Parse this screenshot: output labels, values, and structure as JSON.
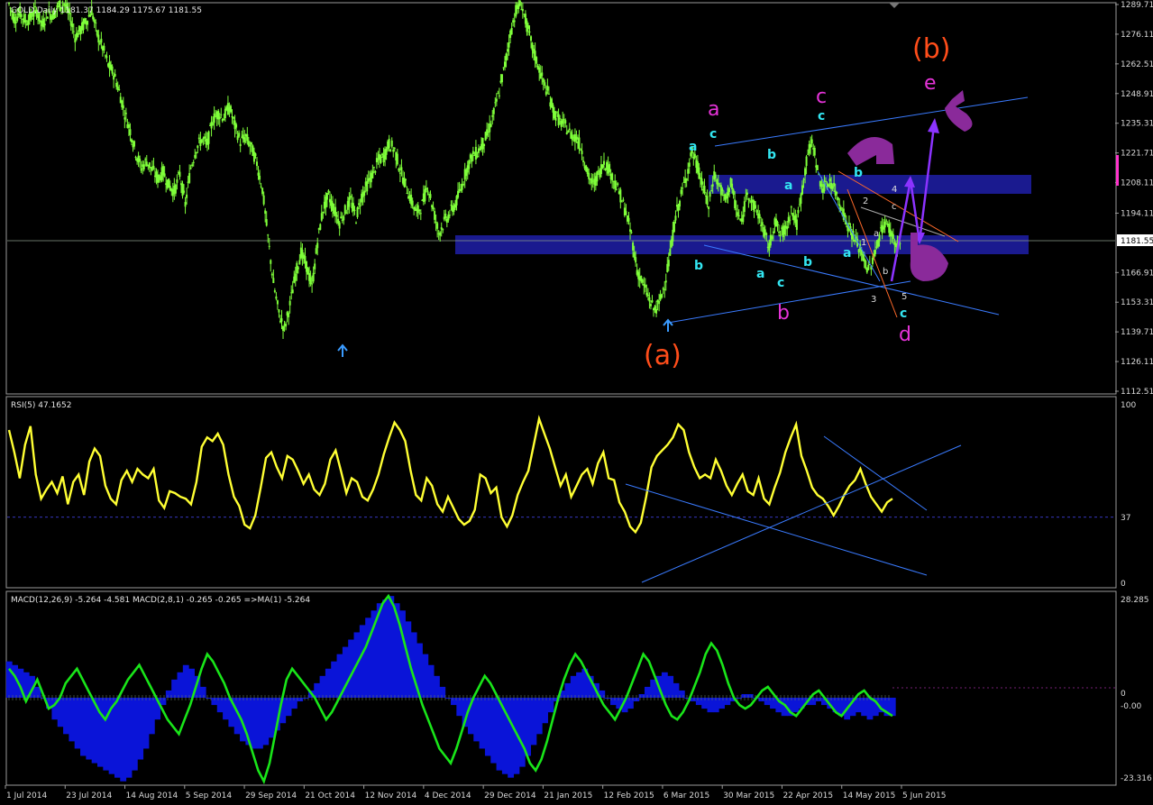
{
  "chart_data": [
    {
      "type": "candlestick",
      "header": "GOLD,Daily  1181.37 1184.29 1175.67 1181.55",
      "symbol": "GOLD",
      "timeframe": "Daily",
      "ohlc_last": {
        "open": 1181.37,
        "high": 1184.29,
        "low": 1175.67,
        "close": 1181.55
      },
      "ylim": [
        1112.51,
        1289.71
      ],
      "yticks": [
        1289.71,
        1276.11,
        1262.51,
        1248.91,
        1235.31,
        1221.71,
        1208.11,
        1194.11,
        1181.55,
        1166.91,
        1153.31,
        1139.71,
        1126.11,
        1112.51
      ],
      "current_price_label": "1181.55",
      "price_path": [
        1290,
        1283,
        1286,
        1282,
        1284,
        1287,
        1280,
        1286,
        1285,
        1289,
        1290,
        1285,
        1275,
        1278,
        1282,
        1287,
        1276,
        1270,
        1262,
        1258,
        1250,
        1240,
        1232,
        1222,
        1215,
        1218,
        1214,
        1210,
        1213,
        1207,
        1204,
        1212,
        1198,
        1215,
        1224,
        1228,
        1226,
        1237,
        1240,
        1238,
        1243,
        1234,
        1227,
        1229,
        1224,
        1217,
        1205,
        1183,
        1162,
        1148,
        1141,
        1152,
        1166,
        1176,
        1170,
        1160,
        1181,
        1196,
        1202,
        1196,
        1190,
        1195,
        1200,
        1192,
        1202,
        1207,
        1212,
        1218,
        1220,
        1226,
        1223,
        1214,
        1207,
        1200,
        1194,
        1198,
        1207,
        1196,
        1185,
        1190,
        1194,
        1198,
        1205,
        1214,
        1220,
        1222,
        1226,
        1231,
        1240,
        1250,
        1262,
        1276,
        1287,
        1290,
        1280,
        1270,
        1262,
        1254,
        1248,
        1240,
        1236,
        1234,
        1230,
        1229,
        1223,
        1212,
        1207,
        1212,
        1218,
        1214,
        1208,
        1202,
        1194,
        1184,
        1168,
        1162,
        1156,
        1150,
        1152,
        1162,
        1175,
        1193,
        1202,
        1212,
        1222,
        1215,
        1206,
        1197,
        1212,
        1206,
        1200,
        1208,
        1196,
        1189,
        1205,
        1198,
        1194,
        1186,
        1178,
        1191,
        1184,
        1187,
        1196,
        1189,
        1205,
        1222,
        1226,
        1210,
        1205,
        1209,
        1204,
        1198,
        1190,
        1185,
        1180,
        1174,
        1168,
        1174,
        1184,
        1190,
        1186,
        1179,
        1181
      ],
      "annotations": [
        "a",
        "c",
        "b",
        "a",
        "b",
        "a",
        "c",
        "b",
        "c",
        "c",
        "b",
        "e",
        "(b)",
        "(a)",
        "a",
        "1",
        "2",
        "3",
        "4",
        "5",
        "a",
        "b",
        "c",
        "d"
      ],
      "overlay_labels": {
        "big_a": "(a)",
        "big_b": "(b)",
        "wave_a": "a",
        "wave_b": "b",
        "wave_c": "c",
        "wave_d": "d",
        "wave_e": "e"
      }
    },
    {
      "type": "line",
      "header": "RSI(5) 47.1652",
      "ylim": [
        0,
        100
      ],
      "yticks": [
        "100",
        "37",
        "0"
      ],
      "level": 37,
      "values": [
        84,
        72,
        58,
        76,
        86,
        60,
        47,
        52,
        56,
        50,
        59,
        44,
        56,
        60,
        49,
        67,
        74,
        70,
        54,
        47,
        44,
        57,
        62,
        56,
        63,
        60,
        58,
        63,
        46,
        42,
        51,
        50,
        48,
        47,
        44,
        56,
        75,
        80,
        78,
        82,
        76,
        60,
        48,
        43,
        33,
        31,
        38,
        53,
        69,
        72,
        64,
        58,
        70,
        68,
        62,
        55,
        60,
        52,
        49,
        55,
        68,
        73,
        62,
        50,
        58,
        56,
        48,
        46,
        52,
        60,
        71,
        80,
        88,
        84,
        78,
        62,
        49,
        46,
        58,
        54,
        44,
        40,
        48,
        42,
        36,
        33,
        35,
        41,
        60,
        58,
        50,
        53,
        37,
        32,
        38,
        49,
        56,
        62,
        76,
        90,
        82,
        74,
        64,
        54,
        60,
        48,
        54,
        60,
        63,
        55,
        66,
        72,
        58,
        57,
        45,
        40,
        32,
        29,
        34,
        48,
        64,
        70,
        73,
        76,
        80,
        87,
        84,
        72,
        64,
        58,
        60,
        58,
        68,
        62,
        54,
        49,
        55,
        60,
        51,
        49,
        58,
        47,
        44,
        53,
        61,
        72,
        80,
        87,
        70,
        62,
        53,
        49,
        47,
        43,
        38,
        43,
        49,
        54,
        57,
        63,
        55,
        48,
        44,
        40,
        45,
        47
      ]
    },
    {
      "type": "histogram+line",
      "header": "MACD(12,26,9) -5.264 -4.581  MACD(2,8,1) -0.265 -0.265  =>MA(1) -5.264",
      "ylim": [
        -23.316,
        28.285
      ],
      "yticks": [
        "28.285",
        "0",
        "-0.00",
        "-23.316"
      ],
      "histogram": [
        10,
        9,
        8,
        7,
        6,
        3,
        0,
        -3,
        -6,
        -8,
        -10,
        -12,
        -14,
        -16,
        -17,
        -18,
        -19,
        -20,
        -21,
        -22,
        -23,
        -22,
        -20,
        -17,
        -14,
        -10,
        -6,
        -2,
        2,
        5,
        7,
        9,
        8,
        6,
        3,
        0,
        -2,
        -4,
        -6,
        -8,
        -10,
        -12,
        -13,
        -14,
        -14,
        -13,
        -11,
        -9,
        -7,
        -5,
        -3,
        -1,
        0,
        2,
        4,
        6,
        8,
        10,
        12,
        14,
        16,
        18,
        20,
        22,
        24,
        26,
        27,
        28,
        26,
        24,
        21,
        18,
        15,
        12,
        9,
        6,
        3,
        0,
        -2,
        -5,
        -8,
        -10,
        -12,
        -14,
        -16,
        -18,
        -20,
        -21,
        -22,
        -21,
        -19,
        -16,
        -13,
        -10,
        -7,
        -4,
        -1,
        2,
        4,
        6,
        7,
        8,
        6,
        4,
        2,
        0,
        -2,
        -3,
        -4,
        -3,
        -1,
        1,
        3,
        5,
        6,
        7,
        6,
        4,
        2,
        0,
        -1,
        -2,
        -3,
        -4,
        -4,
        -3,
        -2,
        -1,
        0,
        1,
        1,
        0,
        -1,
        -2,
        -3,
        -4,
        -5,
        -5,
        -4,
        -3,
        -2,
        -2,
        -1,
        -2,
        -3,
        -4,
        -5,
        -6,
        -5,
        -4,
        -5,
        -6,
        -5,
        -4,
        -5,
        -5
      ],
      "signal": [
        8,
        6,
        3,
        -1,
        2,
        5,
        1,
        -3,
        -2,
        0,
        4,
        6,
        8,
        5,
        2,
        -1,
        -4,
        -6,
        -3,
        -1,
        2,
        5,
        7,
        9,
        6,
        3,
        0,
        -3,
        -6,
        -8,
        -10,
        -6,
        -2,
        3,
        8,
        12,
        10,
        7,
        4,
        0,
        -3,
        -6,
        -10,
        -15,
        -20,
        -23,
        -18,
        -10,
        -2,
        5,
        8,
        6,
        4,
        2,
        0,
        -3,
        -6,
        -4,
        -1,
        2,
        5,
        8,
        11,
        14,
        18,
        22,
        26,
        28,
        25,
        20,
        14,
        8,
        3,
        -2,
        -6,
        -10,
        -14,
        -16,
        -18,
        -14,
        -9,
        -4,
        0,
        3,
        6,
        4,
        1,
        -2,
        -5,
        -8,
        -11,
        -14,
        -18,
        -20,
        -17,
        -12,
        -6,
        0,
        5,
        9,
        12,
        10,
        7,
        4,
        1,
        -2,
        -4,
        -6,
        -3,
        0,
        4,
        8,
        12,
        10,
        6,
        2,
        -2,
        -5,
        -6,
        -4,
        -1,
        3,
        7,
        12,
        15,
        13,
        9,
        4,
        0,
        -2,
        -3,
        -2,
        0,
        2,
        3,
        1,
        -1,
        -2,
        -4,
        -5,
        -3,
        -1,
        1,
        2,
        0,
        -2,
        -4,
        -5,
        -3,
        -1,
        1,
        2,
        0,
        -1,
        -3,
        -4,
        -5
      ]
    }
  ],
  "x_axis_labels": [
    "1 Jul 2014",
    "23 Jul 2014",
    "14 Aug 2014",
    "5 Sep 2014",
    "29 Sep 2014",
    "21 Oct 2014",
    "12 Nov 2014",
    "4 Dec 2014",
    "29 Dec 2014",
    "21 Jan 2015",
    "12 Feb 2015",
    "6 Mar 2015",
    "30 Mar 2015",
    "22 Apr 2015",
    "14 May 2015",
    "5 Jun 2015"
  ],
  "colors": {
    "background": "#000000",
    "grid": "#333333",
    "candles": "#7fff3a",
    "rsi_line": "#ffff33",
    "macd_hist": "#0a14d8",
    "macd_signal": "#19e519",
    "trendline": "#3a7bff",
    "zone": "#1a1a8f",
    "wave_cyan": "#33e6f2",
    "wave_magenta": "#e633d9",
    "big_label": "#ff4d1a",
    "purple": "#8c33c7"
  }
}
